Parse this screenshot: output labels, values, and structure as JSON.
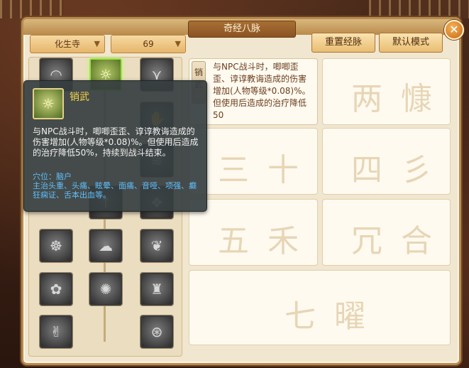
{
  "window": {
    "title": "奇经八脉"
  },
  "close_icon": "close-icon",
  "dropdowns": {
    "sect": {
      "value": "化生寺"
    },
    "level": {
      "value": "69"
    }
  },
  "buttons": {
    "reset": "重置经脉",
    "default_mode": "默认模式"
  },
  "skill_grid": {
    "rows": [
      [
        "rainbow-icon",
        "sun-cloud-icon",
        "claw-icon"
      ],
      [
        "",
        "",
        ""
      ],
      [
        "",
        "",
        ""
      ],
      [
        "",
        "",
        ""
      ],
      [
        "buddha-icon",
        "cloud-icon",
        "leaf-icon"
      ],
      [
        "flower-icon",
        "scorpion-icon",
        "pagoda-icon"
      ],
      [
        "hand-icon",
        "",
        "wheel-icon"
      ]
    ],
    "active": "sun-cloud-icon"
  },
  "detail_panel": {
    "tab_label": "销武",
    "text": "与NPC战斗时，唧唧歪歪、谆谆教诲造成的伤害增加(人物等级*0.08)%。但使用后造成的治疗降低50"
  },
  "slot_glyphs": [
    "两",
    "慷",
    "三",
    "十",
    "四",
    "彡",
    "五",
    "禾",
    "冗",
    "合",
    "七",
    "曜"
  ],
  "tooltip": {
    "name": "销武",
    "description": "与NPC战斗时，唧唧歪歪、谆谆教诲造成的伤害增加(人物等级*0.08)%。但使用后造成的治疗降低50%，持续到战斗结束。",
    "acupoint": "穴位：脑户",
    "indication": "主治头重、头痛、眩晕、面痛、音哑、项强、癫狂痫证、舌本出血等。"
  },
  "colors": {
    "frame": "#b88a4f",
    "active_skill": "#9be04a",
    "tooltip_name": "#f6d64a",
    "tooltip_acupoint": "#5fc0ff"
  }
}
